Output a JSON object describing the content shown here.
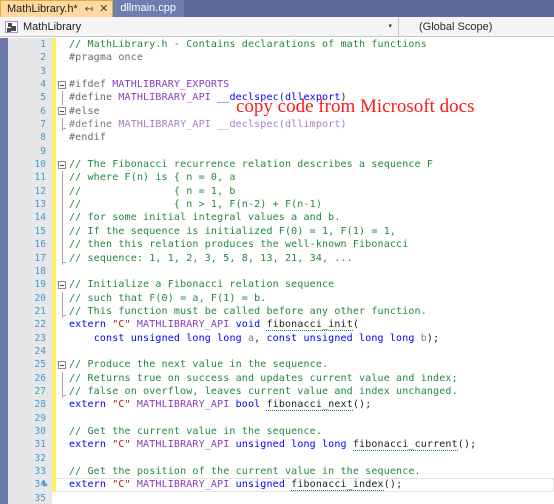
{
  "tabs": [
    {
      "label": "MathLibrary.h*",
      "active": true,
      "pin": "↤",
      "close": "✕"
    },
    {
      "label": "dllmain.cpp",
      "active": false
    }
  ],
  "navbar": {
    "icon": "class-member-icon",
    "scope_left": "MathLibrary",
    "caret": "▾",
    "scope_right": "(Global Scope)"
  },
  "annotation": {
    "text": "copy code from Microsoft docs",
    "color": "#ff1a1a"
  },
  "editor": {
    "filename": "MathLibrary.h",
    "first_line": 1,
    "last_line": 35,
    "change_bar_color": "#fbf063",
    "gutter_color": "#e6e7e9",
    "indicator_color": "#6b7aa8",
    "lines": [
      {
        "n": 1,
        "chg": true,
        "fold": "none",
        "html": "<span class='c-com'>// MathLibrary.h - Contains declarations of math functions</span>"
      },
      {
        "n": 2,
        "chg": true,
        "fold": "none",
        "html": "<span class='c-pre'>#pragma once</span>"
      },
      {
        "n": 3,
        "chg": true,
        "fold": "none",
        "html": ""
      },
      {
        "n": 4,
        "chg": true,
        "fold": "open",
        "html": "<span class='c-pre'>#ifdef </span><span class='c-mac'>MATHLIBRARY_EXPORTS</span>"
      },
      {
        "n": 5,
        "chg": true,
        "fold": "mid",
        "html": "<span class='c-pre'>#define </span><span class='c-mac'>MATHLIBRARY_API </span><span class='c-kw'>__declspec</span><span class='c-plain'>(</span><span class='c-kw'>dllexport</span><span class='c-plain'>)</span>"
      },
      {
        "n": 6,
        "chg": true,
        "fold": "open",
        "html": "<span class='c-pre'>#else</span>"
      },
      {
        "n": 7,
        "chg": true,
        "fold": "endmid",
        "html": "<span class='c-pre2'>#define </span><span class='c-mac2'>MATHLIBRARY_API </span><span class='c-mac2'>__declspec</span><span class='c-mac2'>(</span><span class='c-mac2'>dllimport</span><span class='c-mac2'>)</span>"
      },
      {
        "n": 8,
        "chg": true,
        "fold": "none",
        "html": "<span class='c-pre'>#endif</span>"
      },
      {
        "n": 9,
        "chg": true,
        "fold": "none",
        "html": ""
      },
      {
        "n": 10,
        "chg": true,
        "fold": "open",
        "html": "<span class='c-com'>// The Fibonacci recurrence relation describes a sequence F</span>"
      },
      {
        "n": 11,
        "chg": true,
        "fold": "mid",
        "html": "<span class='c-com'>// where F(n) is { n = 0, a</span>"
      },
      {
        "n": 12,
        "chg": true,
        "fold": "mid",
        "html": "<span class='c-com'>//               { n = 1, b</span>"
      },
      {
        "n": 13,
        "chg": true,
        "fold": "mid",
        "html": "<span class='c-com'>//               { n > 1, F(n-2) + F(n-1)</span>"
      },
      {
        "n": 14,
        "chg": true,
        "fold": "mid",
        "html": "<span class='c-com'>// for some initial integral values a and b.</span>"
      },
      {
        "n": 15,
        "chg": true,
        "fold": "mid",
        "html": "<span class='c-com'>// If the sequence is initialized F(0) = 1, F(1) = 1,</span>"
      },
      {
        "n": 16,
        "chg": true,
        "fold": "mid",
        "html": "<span class='c-com'>// then this relation produces the well-known Fibonacci</span>"
      },
      {
        "n": 17,
        "chg": true,
        "fold": "endmid",
        "html": "<span class='c-com'>// sequence: 1, 1, 2, 3, 5, 8, 13, 21, 34, ...</span>"
      },
      {
        "n": 18,
        "chg": true,
        "fold": "none",
        "html": ""
      },
      {
        "n": 19,
        "chg": true,
        "fold": "open",
        "html": "<span class='c-com'>// Initialize a Fibonacci relation sequence</span>"
      },
      {
        "n": 20,
        "chg": true,
        "fold": "mid",
        "html": "<span class='c-com'>// such that F(0) = a, F(1) = b.</span>"
      },
      {
        "n": 21,
        "chg": true,
        "fold": "endmid",
        "html": "<span class='c-com'>// This function must be called before any other function.</span>"
      },
      {
        "n": 22,
        "chg": true,
        "fold": "none",
        "html": "<span class='c-kw'>extern </span><span class='c-str'>\"C\" </span><span class='c-mac'>MATHLIBRARY_API </span><span class='c-kw'>void </span><span class='c-fn squig'>fibonacci_init</span><span class='c-plain'>(</span>"
      },
      {
        "n": 23,
        "chg": true,
        "fold": "none",
        "html": "<span class='c-plain'>    </span><span class='c-kw'>const unsigned long long </span><span class='c-param'>a</span><span class='c-plain'>, </span><span class='c-kw'>const unsigned long long </span><span class='c-param'>b</span><span class='c-plain'>);</span>"
      },
      {
        "n": 24,
        "chg": true,
        "fold": "none",
        "html": ""
      },
      {
        "n": 25,
        "chg": true,
        "fold": "open",
        "html": "<span class='c-com'>// Produce the next value in the sequence.</span>"
      },
      {
        "n": 26,
        "chg": true,
        "fold": "mid",
        "html": "<span class='c-com'>// Returns true on success and updates current value and index;</span>"
      },
      {
        "n": 27,
        "chg": true,
        "fold": "endmid",
        "html": "<span class='c-com'>// false on overflow, leaves current value and index unchanged.</span>"
      },
      {
        "n": 28,
        "chg": true,
        "fold": "none",
        "html": "<span class='c-kw'>extern </span><span class='c-str'>\"C\" </span><span class='c-mac'>MATHLIBRARY_API </span><span class='c-kw'>bool </span><span class='c-fn squig'>fibonacci_next</span><span class='c-plain'>();</span>"
      },
      {
        "n": 29,
        "chg": true,
        "fold": "none",
        "html": ""
      },
      {
        "n": 30,
        "chg": true,
        "fold": "none",
        "html": "<span class='c-com'>// Get the current value in the sequence.</span>"
      },
      {
        "n": 31,
        "chg": true,
        "fold": "none",
        "html": "<span class='c-kw'>extern </span><span class='c-str'>\"C\" </span><span class='c-mac'>MATHLIBRARY_API </span><span class='c-kw'>unsigned long long </span><span class='c-fn squig'>fibonacci_current</span><span class='c-plain'>();</span>"
      },
      {
        "n": 32,
        "chg": true,
        "fold": "none",
        "html": ""
      },
      {
        "n": 33,
        "chg": true,
        "fold": "none",
        "html": "<span class='c-com'>// Get the position of the current value in the sequence.</span>"
      },
      {
        "n": 34,
        "chg": true,
        "fold": "none",
        "edit": true,
        "current": true,
        "html": "<span class='c-kw'>extern </span><span class='c-str'>\"C\" </span><span class='c-mac'>MATHLIBRARY_API </span><span class='c-kw'>unsigned </span><span class='c-fn squig'>fibonacci_index</span><span class='c-plain'>();</span>"
      },
      {
        "n": 35,
        "chg": false,
        "fold": "none",
        "html": ""
      }
    ]
  }
}
